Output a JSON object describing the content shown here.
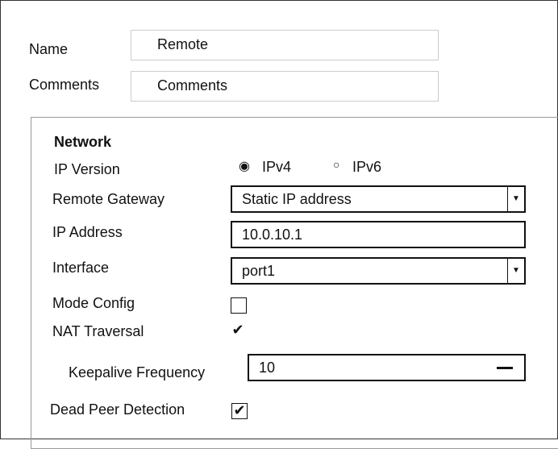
{
  "name": {
    "label": "Name",
    "value": "Remote"
  },
  "comments": {
    "label": "Comments",
    "placeholder": "Comments"
  },
  "network": {
    "title": "Network",
    "ip_version": {
      "label": "IP Version",
      "options": [
        "IPv4",
        "IPv6"
      ],
      "selected": "IPv4"
    },
    "remote_gateway": {
      "label": "Remote Gateway",
      "value": "Static IP address"
    },
    "ip_address": {
      "label": "IP Address",
      "value": "10.0.10.1"
    },
    "interface": {
      "label": "Interface",
      "value": "port1"
    },
    "mode_config": {
      "label": "Mode Config",
      "checked": false
    },
    "nat_traversal": {
      "label": "NAT Traversal",
      "checked": true
    },
    "keepalive": {
      "label": "Keepalive Frequency",
      "value": "10"
    },
    "dpd": {
      "label": "Dead Peer Detection",
      "checked": true
    }
  }
}
